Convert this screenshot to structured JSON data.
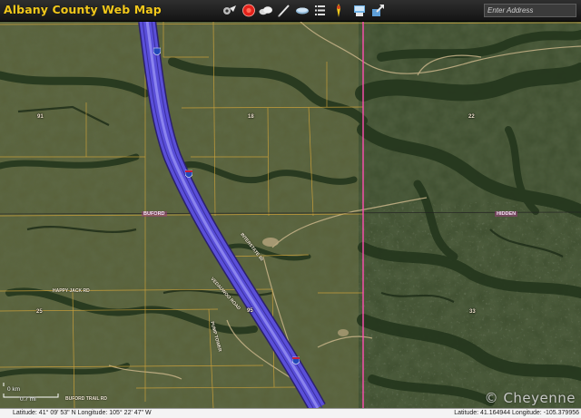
{
  "app": {
    "title": "Albany County Web Map"
  },
  "toolbar": {
    "tools": [
      {
        "name": "navigation-tool-icon"
      },
      {
        "name": "stop-tool-icon"
      },
      {
        "name": "cloud-tool-icon"
      },
      {
        "name": "measure-pen-tool-icon"
      },
      {
        "name": "eraser-tool-icon"
      },
      {
        "name": "layers-list-tool-icon"
      },
      {
        "name": "identify-tool-icon"
      },
      {
        "name": "print-tool-icon"
      },
      {
        "name": "export-tool-icon"
      }
    ]
  },
  "search": {
    "placeholder": "Enter Address"
  },
  "map": {
    "area_labels": [
      "91",
      "84",
      "18",
      "22",
      "25",
      "95",
      "33"
    ],
    "road_labels": [
      "INTERSTATE 80",
      "VEDAUWOO ROAD",
      "HAPPY JACK RD",
      "PUMP TOWER",
      "BUFORD TRAIL RD"
    ],
    "place_labels": [
      "BUFORD",
      "HIDDEN"
    ],
    "highway_shield": "80",
    "scale": {
      "km": "0 km",
      "mi": "0.7 mi"
    },
    "watermark": "© Cheyenne",
    "colors": {
      "highway": "#5a4fd8",
      "parcel_lines": "#d9a83a",
      "county_line": "#ff4fb0"
    }
  },
  "status": {
    "left": "Latitude: 41° 09' 53\" N Longitude: 105° 22' 47\" W",
    "right": "Latitude: 41.164944 Longitude: -105.379956"
  }
}
